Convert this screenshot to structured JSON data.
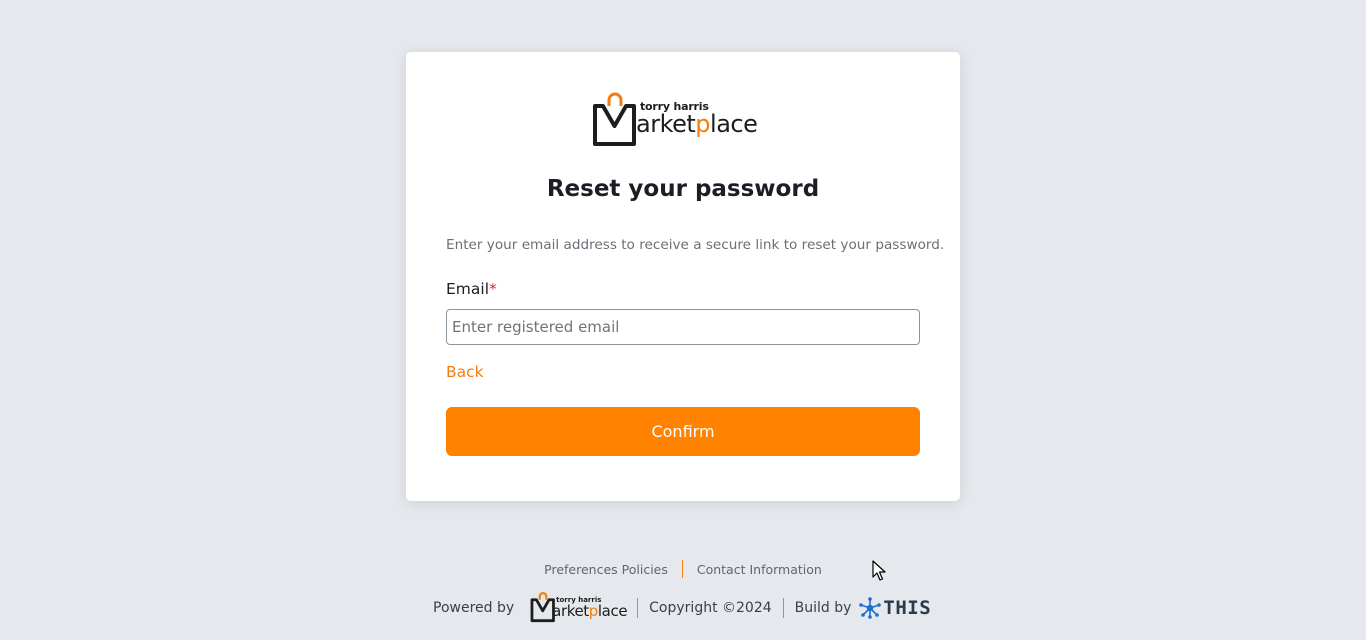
{
  "brand": {
    "tagline": "torry harris",
    "wordmark_pre": "arket",
    "wordmark_p": "p",
    "wordmark_post": "lace",
    "accent_color": "#ff8200"
  },
  "form": {
    "title": "Reset your password",
    "description": "Enter your email address to receive a secure link to reset your password.",
    "email_label": "Email",
    "required_marker": "*",
    "email_placeholder": "Enter registered email",
    "email_value": "",
    "back_label": "Back",
    "confirm_label": "Confirm"
  },
  "footer": {
    "links": [
      "Preferences Policies",
      "Contact Information"
    ],
    "powered_by": "Powered by",
    "copyright": "Copyright ©2024",
    "build_by": "Build by",
    "build_by_brand": "THIS"
  },
  "icons": {
    "logo": "marketplace-bag-icon",
    "build_brand": "this-network-icon",
    "cursor": "mouse-pointer-icon"
  }
}
